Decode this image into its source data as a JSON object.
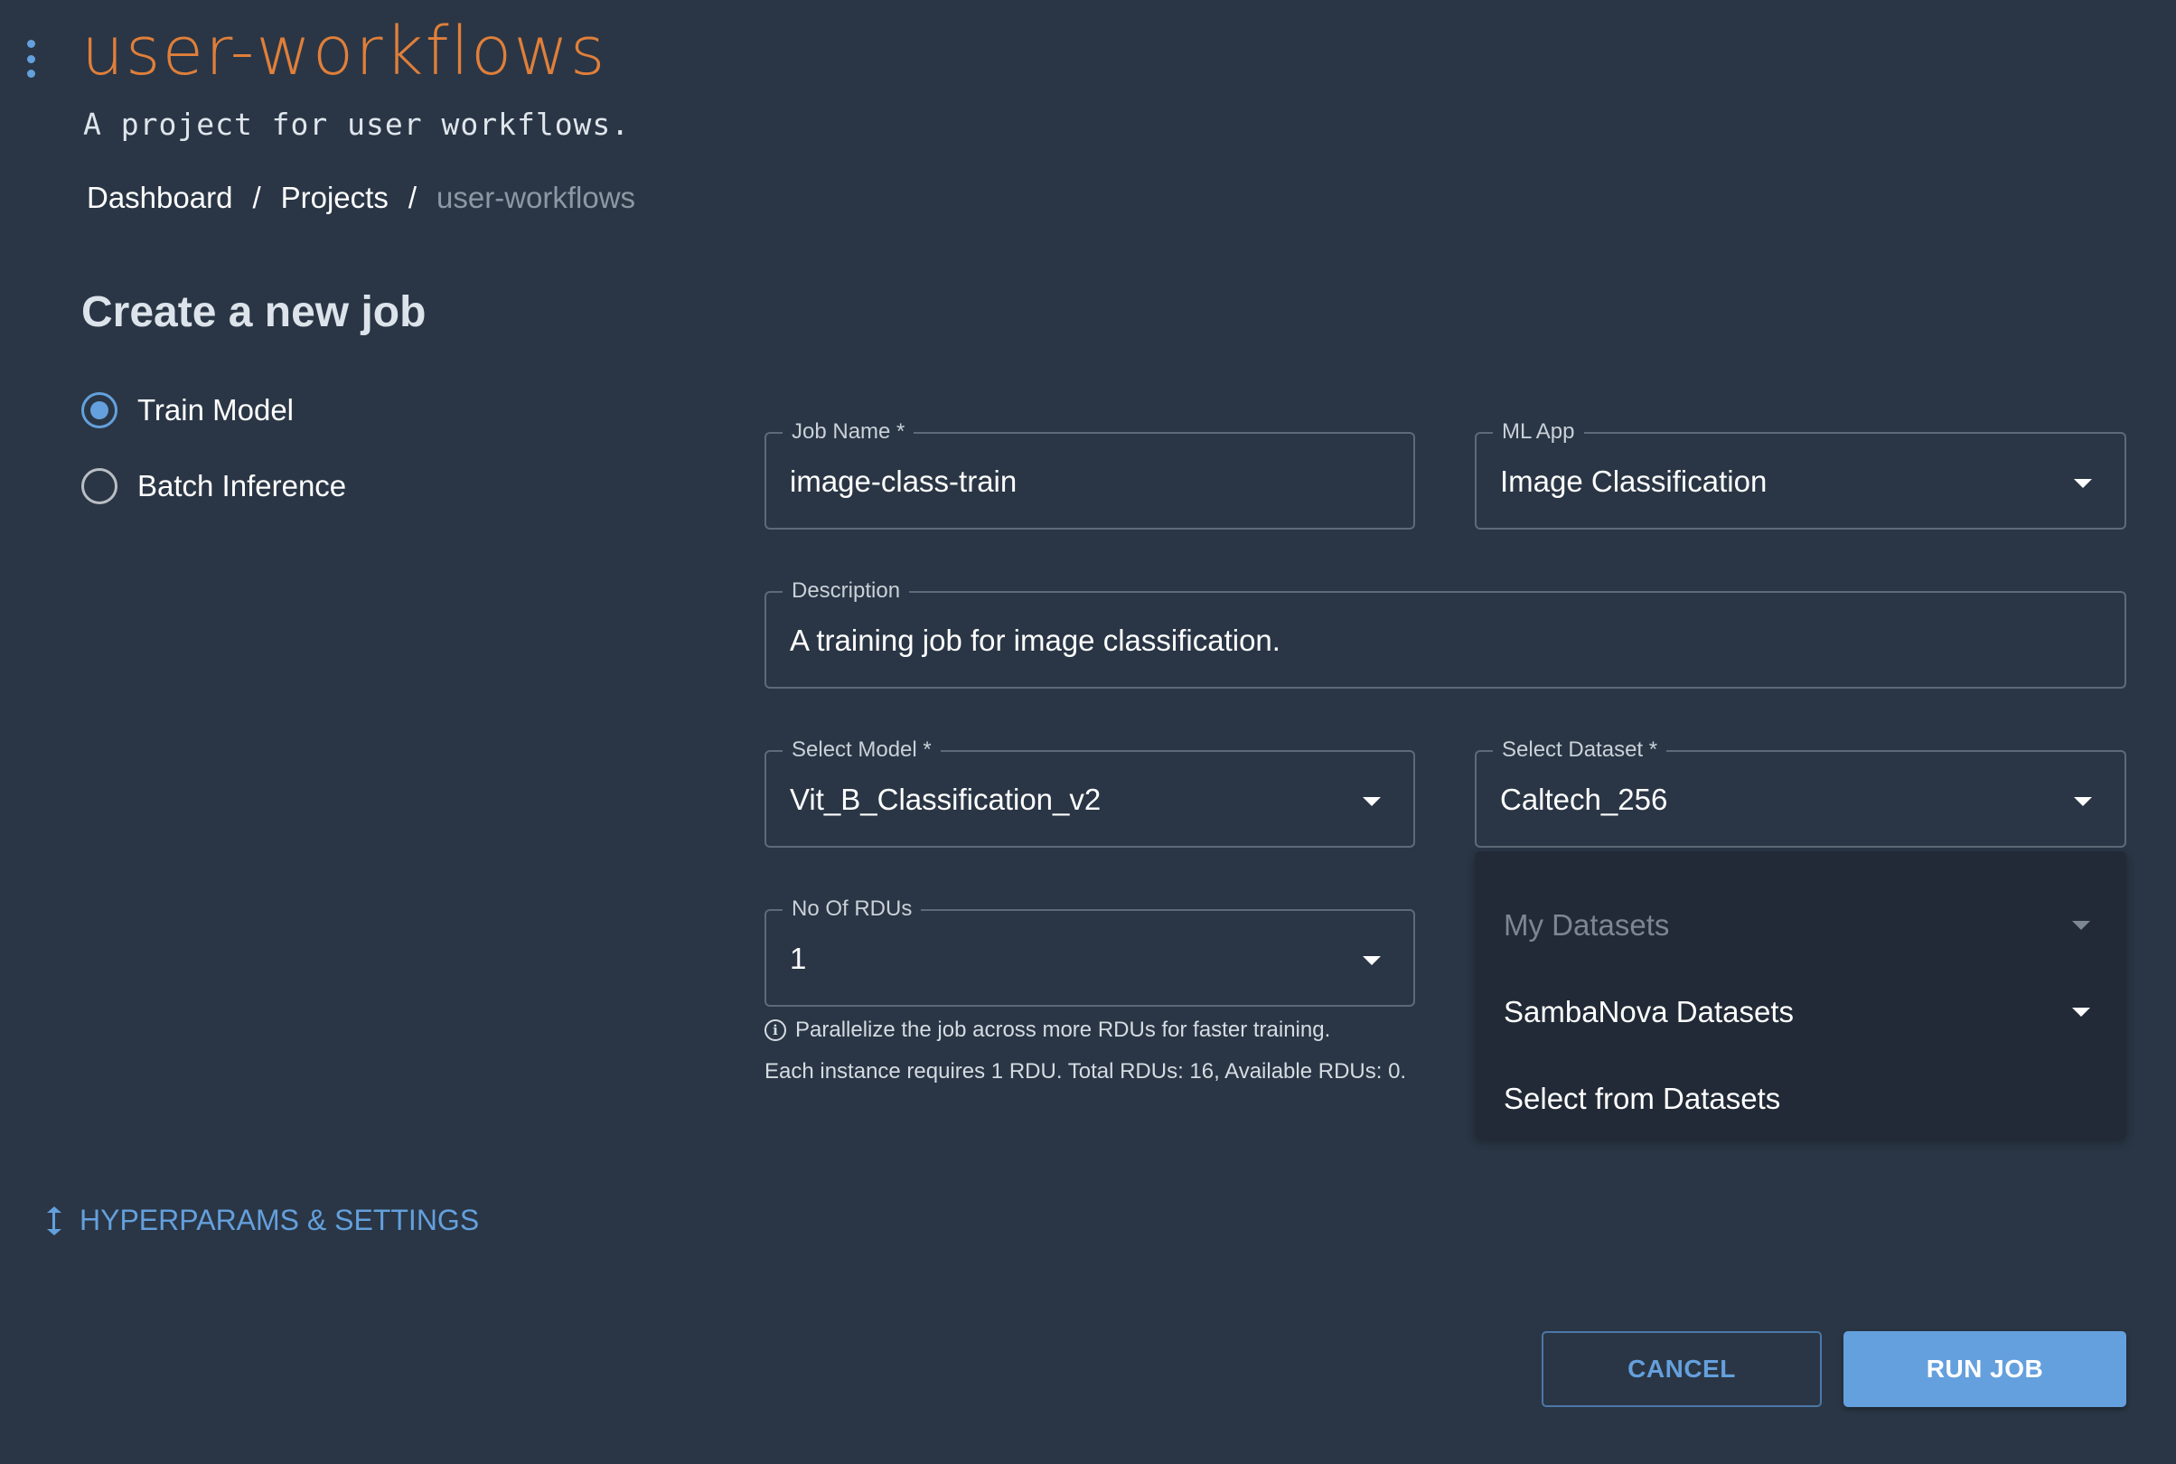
{
  "header": {
    "menu_icon": "kebab-vertical-icon",
    "title": "user-workflows",
    "subtitle": "A project for user workflows."
  },
  "breadcrumb": {
    "items": [
      "Dashboard",
      "Projects",
      "user-workflows"
    ],
    "separator": "/"
  },
  "form": {
    "title": "Create a new job",
    "job_types": [
      {
        "label": "Train Model",
        "selected": true
      },
      {
        "label": "Batch Inference",
        "selected": false
      }
    ],
    "job_name": {
      "label": "Job Name *",
      "value": "image-class-train"
    },
    "ml_app": {
      "label": "ML App",
      "value": "Image Classification"
    },
    "description": {
      "label": "Description",
      "value": "A training job for image classification."
    },
    "model": {
      "label": "Select Model *",
      "value": "Vit_B_Classification_v2"
    },
    "dataset": {
      "label": "Select Dataset *",
      "value": "Caltech_256",
      "menu": [
        {
          "label": "My Datasets",
          "disabled": true,
          "has_submenu": true
        },
        {
          "label": "SambaNova Datasets",
          "disabled": false,
          "has_submenu": true
        },
        {
          "label": "Select from Datasets",
          "disabled": false,
          "has_submenu": false
        }
      ]
    },
    "rdus": {
      "label": "No Of RDUs",
      "value": "1",
      "help": "Parallelize the job across more RDUs for faster training.",
      "info": "Each instance requires 1 RDU. Total RDUs: 16, Available RDUs: 0."
    },
    "hyperparams_label": "HYPERPARAMS & SETTINGS",
    "cancel_label": "CANCEL",
    "run_label": "RUN JOB"
  },
  "colors": {
    "background": "#2a3645",
    "accent": "#64a0dd",
    "title": "#e07f3a",
    "menu_background": "#212a36"
  }
}
